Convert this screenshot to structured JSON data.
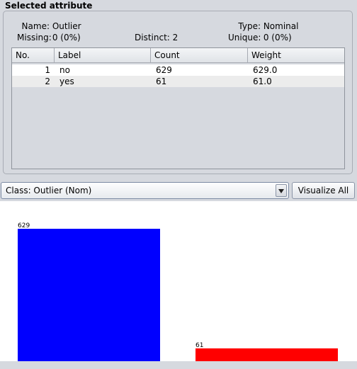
{
  "panel": {
    "title": "Selected attribute",
    "name_label": "Name:",
    "name_value": "Outlier",
    "type_label": "Type:",
    "type_value": "Nominal",
    "missing_label": "Missing:",
    "missing_value": "0 (0%)",
    "distinct_label": "Distinct:",
    "distinct_value": "2",
    "unique_label": "Unique:",
    "unique_value": "0 (0%)"
  },
  "table": {
    "columns": [
      "No.",
      "Label",
      "Count",
      "Weight"
    ],
    "rows": [
      {
        "no": "1",
        "label": "no",
        "count": "629",
        "weight": "629.0"
      },
      {
        "no": "2",
        "label": "yes",
        "count": "61",
        "weight": "61.0"
      }
    ]
  },
  "class_select": {
    "value": "Class: Outlier (Nom)"
  },
  "visualize_all": {
    "label": "Visualize All"
  },
  "chart_data": {
    "type": "bar",
    "categories": [
      "no",
      "yes"
    ],
    "values": [
      629,
      61
    ],
    "data_labels": [
      "629",
      "61"
    ],
    "colors": [
      "#0000ff",
      "#ff0000"
    ],
    "ylim": [
      0,
      629
    ]
  }
}
